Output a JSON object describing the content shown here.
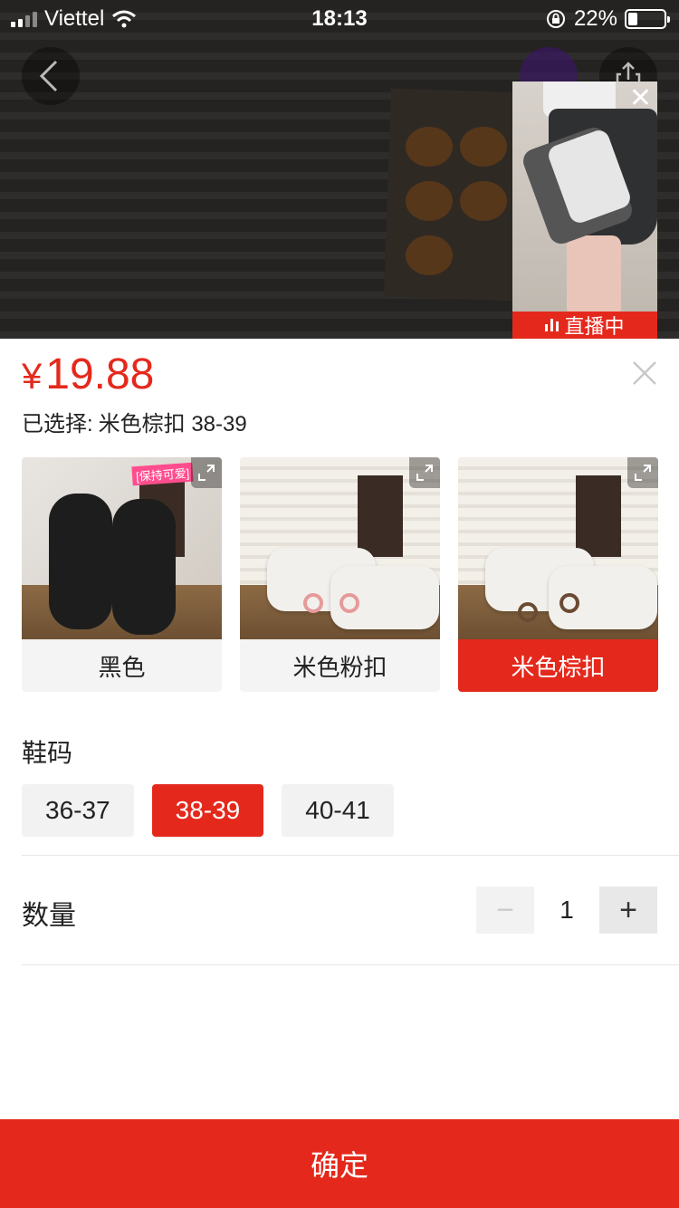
{
  "status_bar": {
    "carrier": "Viettel",
    "time": "18:13",
    "battery": "22%"
  },
  "live": {
    "badge": "直播中"
  },
  "product": {
    "currency": "¥",
    "price": "19.88",
    "selected_label": "已选择:",
    "selected_value": "米色棕扣 38-39"
  },
  "variants": [
    {
      "label": "黑色",
      "active": false
    },
    {
      "label": "米色粉扣",
      "active": false
    },
    {
      "label": "米色棕扣",
      "active": true
    }
  ],
  "variant_badge": "[保持可爱]",
  "size_section": {
    "title": "鞋码",
    "options": [
      {
        "label": "36-37",
        "active": false
      },
      {
        "label": "38-39",
        "active": true
      },
      {
        "label": "40-41",
        "active": false
      }
    ]
  },
  "quantity": {
    "label": "数量",
    "value": "1",
    "minus": "−",
    "plus": "+"
  },
  "confirm_label": "确定",
  "colors": {
    "accent": "#e4291c"
  }
}
